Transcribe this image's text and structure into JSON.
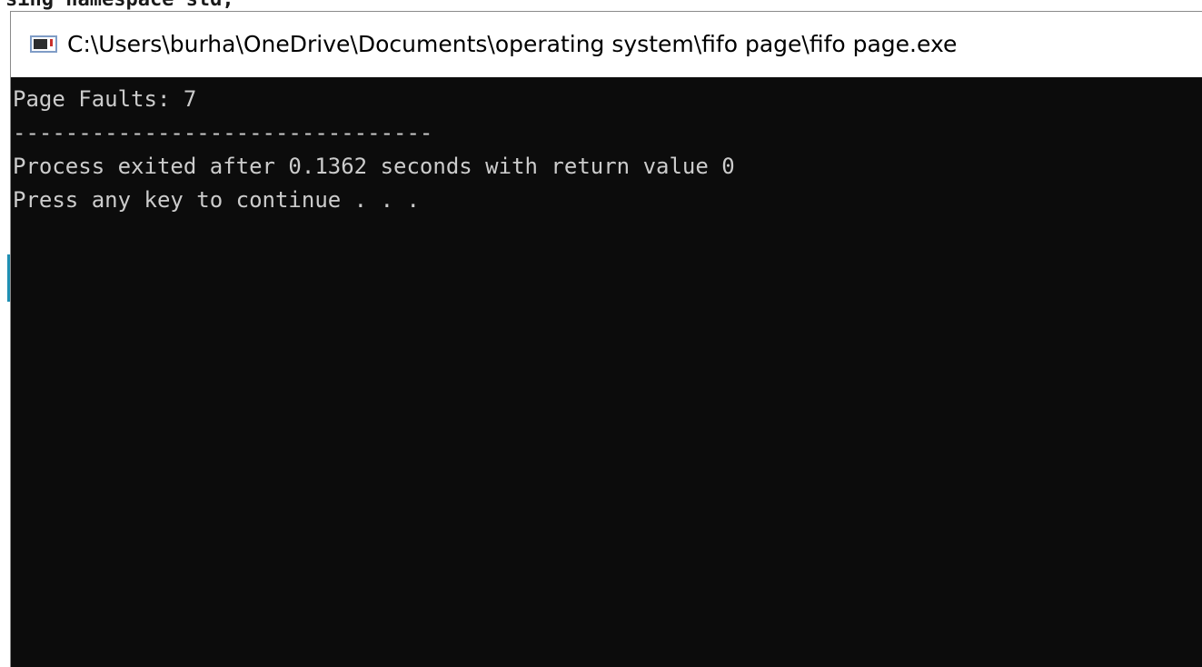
{
  "background_editor": {
    "visible_code_fragment": "sing namespace std;"
  },
  "window": {
    "title": "C:\\Users\\burha\\OneDrive\\Documents\\operating system\\fifo page\\fifo page.exe",
    "icon": "console-app-icon"
  },
  "console": {
    "lines": [
      "Page Faults: 7",
      "--------------------------------",
      "Process exited after 0.1362 seconds with return value 0",
      "Press any key to continue . . ."
    ]
  },
  "colors": {
    "console_background": "#0c0c0c",
    "console_text": "#cccccc",
    "title_bar_background": "#ffffff",
    "title_text": "#000000"
  }
}
